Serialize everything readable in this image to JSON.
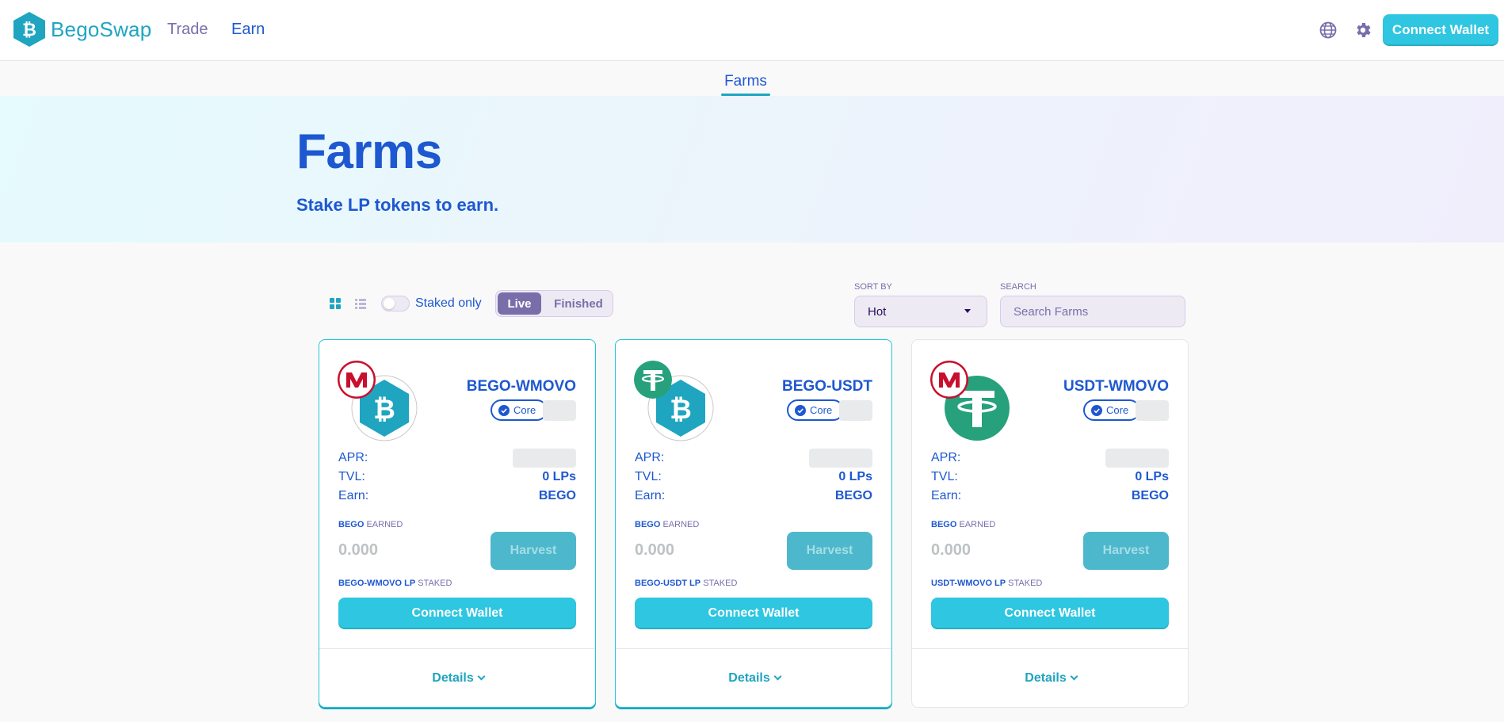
{
  "nav": {
    "brand": "BegoSwap",
    "links": [
      "Trade",
      "Earn"
    ],
    "connect_label": "Connect Wallet",
    "icons": [
      "globe-icon",
      "gear-icon"
    ]
  },
  "subnav": {
    "active_tab": "Farms"
  },
  "hero": {
    "title": "Farms",
    "subtitle": "Stake LP tokens to earn."
  },
  "controls": {
    "staked_only_label": "Staked only",
    "staked_only_on": false,
    "segments": [
      "Live",
      "Finished"
    ],
    "active_segment": "Live",
    "sort_by_label": "SORT BY",
    "sort_value": "Hot",
    "search_label": "SEARCH",
    "search_placeholder": "Search Farms"
  },
  "farms": [
    {
      "pair": "BEGO-WMOVO",
      "badge": "Core",
      "apr_label": "APR:",
      "tvl_label": "TVL:",
      "tvl_value": "0 LPs",
      "earn_label": "Earn:",
      "earn_value": "BEGO",
      "earned_token": "BEGO",
      "earned_suffix": "EARNED",
      "earned_value": "0.000",
      "harvest_label": "Harvest",
      "staked_token": "BEGO-WMOVO LP",
      "staked_suffix": "STAKED",
      "connect_label": "Connect Wallet",
      "details_label": "Details",
      "token_big": "bego-logo-icon",
      "token_small": "wmovo-logo-icon"
    },
    {
      "pair": "BEGO-USDT",
      "badge": "Core",
      "apr_label": "APR:",
      "tvl_label": "TVL:",
      "tvl_value": "0 LPs",
      "earn_label": "Earn:",
      "earn_value": "BEGO",
      "earned_token": "BEGO",
      "earned_suffix": "EARNED",
      "earned_value": "0.000",
      "harvest_label": "Harvest",
      "staked_token": "BEGO-USDT LP",
      "staked_suffix": "STAKED",
      "connect_label": "Connect Wallet",
      "details_label": "Details",
      "token_big": "bego-logo-icon",
      "token_small": "usdt-logo-icon"
    },
    {
      "pair": "USDT-WMOVO",
      "badge": "Core",
      "apr_label": "APR:",
      "tvl_label": "TVL:",
      "tvl_value": "0 LPs",
      "earn_label": "Earn:",
      "earn_value": "BEGO",
      "earned_token": "BEGO",
      "earned_suffix": "EARNED",
      "earned_value": "0.000",
      "harvest_label": "Harvest",
      "staked_token": "USDT-WMOVO LP",
      "staked_suffix": "STAKED",
      "connect_label": "Connect Wallet",
      "details_label": "Details",
      "token_big": "usdt-logo-icon",
      "token_small": "wmovo-logo-icon"
    }
  ],
  "colors": {
    "primary": "#1fc7d4",
    "brand_blue": "#1e58d0",
    "secondary": "#7a6eaa",
    "background": "#faf9fa",
    "usdt_green": "#26a17b",
    "wmovo_red": "#c8102e"
  }
}
